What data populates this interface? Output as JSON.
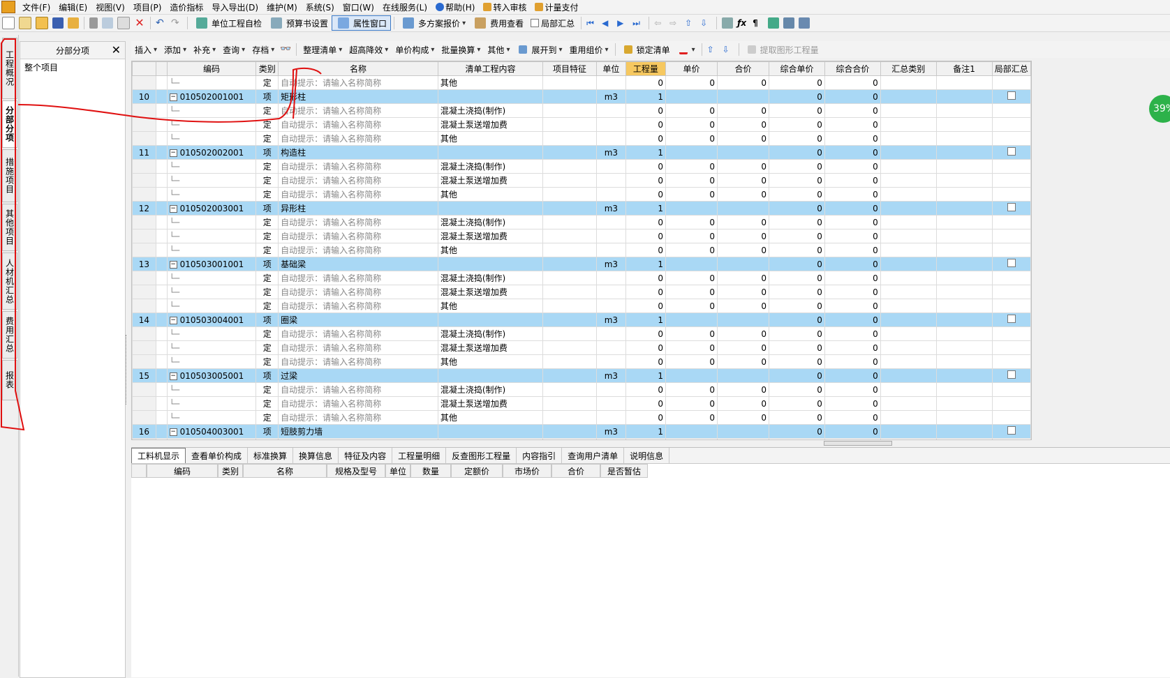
{
  "menubar": {
    "items": [
      "文件(F)",
      "编辑(E)",
      "视图(V)",
      "项目(P)",
      "造价指标",
      "导入导出(D)",
      "维护(M)",
      "系统(S)",
      "窗口(W)",
      "在线服务(L)",
      "帮助(H)",
      "转入审核",
      "计量支付"
    ]
  },
  "toolbar1": {
    "unit_check": "单位工程自检",
    "budget_setting": "预算书设置",
    "property_window": "属性窗口",
    "multi_quote": "多方案报价",
    "fee_view": "费用查看",
    "local_summary": "局部汇总"
  },
  "toolbar2": {
    "insert": "插入",
    "add": "添加",
    "supplement": "补充",
    "query": "查询",
    "archive": "存档",
    "organize": "整理清单",
    "super_height": "超高降效",
    "unit_price_comp": "单价构成",
    "batch_convert": "批量换算",
    "other": "其他",
    "expand_to": "展开到",
    "reuse_price": "重用组价",
    "lock_list": "锁定清单",
    "extract": "提取图形工程量"
  },
  "side_tabs": [
    "工程概况",
    "分部分项",
    "措施项目",
    "其他项目",
    "人材机汇总",
    "费用汇总",
    "报表"
  ],
  "tree": {
    "title": "分部分项",
    "root": "整个项目"
  },
  "grid": {
    "headers": [
      "",
      "",
      "编码",
      "类别",
      "名称",
      "清单工程内容",
      "项目特征",
      "单位",
      "工程量",
      "单价",
      "合价",
      "综合单价",
      "综合合价",
      "汇总类别",
      "备注1",
      "局部汇总"
    ],
    "hint": "自动提示：请输入名称简称",
    "sub_kind": "定",
    "item_kind": "项",
    "unit": "m3",
    "content": [
      "混凝土浇捣(制作)",
      "混凝土泵送增加费",
      "其他"
    ],
    "items": [
      {
        "no": "10",
        "code": "010502001001",
        "name": "矩形柱"
      },
      {
        "no": "11",
        "code": "010502002001",
        "name": "构造柱"
      },
      {
        "no": "12",
        "code": "010502003001",
        "name": "异形柱"
      },
      {
        "no": "13",
        "code": "010503001001",
        "name": "基础梁"
      },
      {
        "no": "14",
        "code": "010503004001",
        "name": "圈梁"
      },
      {
        "no": "15",
        "code": "010503005001",
        "name": "过梁"
      },
      {
        "no": "16",
        "code": "010504003001",
        "name": "短肢剪力墙"
      }
    ]
  },
  "bottom": {
    "tabs": [
      "工料机显示",
      "查看单价构成",
      "标准换算",
      "换算信息",
      "特征及内容",
      "工程量明细",
      "反查图形工程量",
      "内容指引",
      "查询用户清单",
      "说明信息"
    ],
    "headers": [
      "编码",
      "类别",
      "名称",
      "规格及型号",
      "单位",
      "数量",
      "定额价",
      "市场价",
      "合价",
      "是否暂估"
    ]
  },
  "badge": "39%"
}
